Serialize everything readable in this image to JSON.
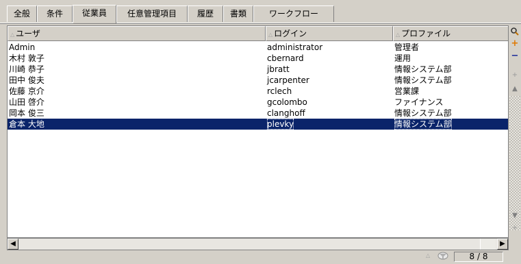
{
  "tabs": [
    "全般",
    "条件",
    "従業員",
    "任意管理項目",
    "履歴",
    "書類",
    "ワークフロー"
  ],
  "table": {
    "columns": [
      "ユーザ",
      "ログイン",
      "プロファイル"
    ],
    "rows": [
      {
        "user": "Admin",
        "login": "administrator",
        "profile": "管理者"
      },
      {
        "user": "木村 敦子",
        "login": "cbernard",
        "profile": "運用"
      },
      {
        "user": "川崎 恭子",
        "login": "jbratt",
        "profile": "情報システム部"
      },
      {
        "user": "田中 俊夫",
        "login": "jcarpenter",
        "profile": "情報システム部"
      },
      {
        "user": "佐藤 京介",
        "login": "rclech",
        "profile": "営業課"
      },
      {
        "user": "山田 啓介",
        "login": "gcolombo",
        "profile": "ファイナンス"
      },
      {
        "user": "岡本 俊三",
        "login": "clanghoff",
        "profile": "情報システム部"
      },
      {
        "user": "倉本 大地",
        "login": "plevky",
        "profile": "情報システム部"
      }
    ]
  },
  "status": {
    "record_count": "8 / 8"
  },
  "icons": {
    "search": "magnifier-icon",
    "add": "plus-icon",
    "remove": "minus-icon",
    "expand": "small-plus-icon",
    "scroll_up": "triangle-up-icon",
    "scroll_down": "triangle-down-icon",
    "scroll_left": "triangle-left-icon",
    "scroll_right": "triangle-right-icon",
    "filter": "filter-icon"
  },
  "colors": {
    "selection": "#0a246a",
    "add": "#e07800",
    "remove": "#1a2a9a"
  }
}
